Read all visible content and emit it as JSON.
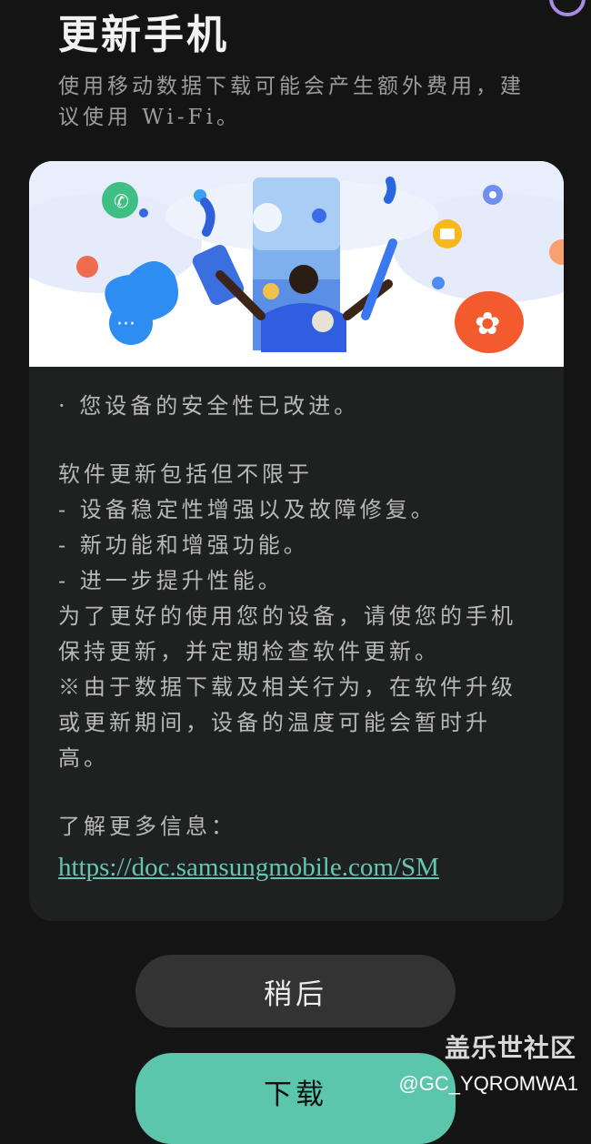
{
  "header": {
    "title": "更新手机",
    "subtitle": "使用移动数据下载可能会产生额外费用，建议使用 Wi-Fi。"
  },
  "release_notes": {
    "security_line": "· 您设备的安全性已改进。",
    "includes_heading": "软件更新包括但不限于",
    "items": [
      " - 设备稳定性增强以及故障修复。",
      " - 新功能和增强功能。",
      " - 进一步提升性能。"
    ],
    "advice": "为了更好的使用您的设备，请使您的手机保持更新，并定期检查软件更新。",
    "warning": "※由于数据下载及相关行为，在软件升级或更新期间，设备的温度可能会暂时升高。",
    "more_info_label": "了解更多信息：",
    "more_info_link": "https://doc.samsungmobile.com/SM"
  },
  "buttons": {
    "later": "稍后",
    "download": "下载"
  },
  "watermark": {
    "community": "盖乐世社区",
    "user": "@GC_YQROMWA1"
  },
  "colors": {
    "background": "#141414",
    "card": "#1f2020",
    "accent": "#5cc6ac",
    "link": "#64c7b1"
  }
}
